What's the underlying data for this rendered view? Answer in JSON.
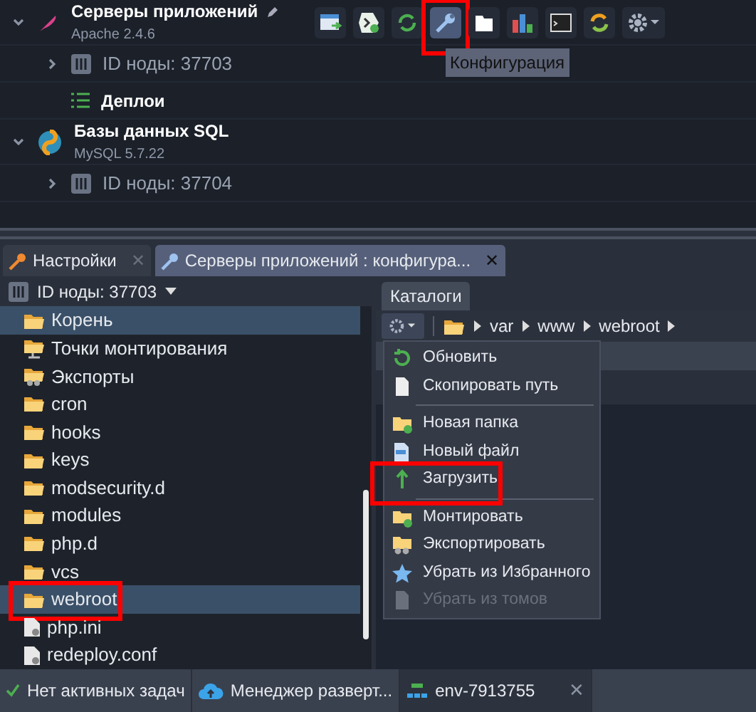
{
  "environment_tree": [
    {
      "kind": "group",
      "title": "Серверы приложений",
      "subtitle": "Apache 2.4.6",
      "expanded": true,
      "editable": true,
      "children": [
        {
          "kind": "node",
          "label": "ID ноды: 37703",
          "expanded": false
        },
        {
          "kind": "deploy",
          "label": "Деплои"
        }
      ]
    },
    {
      "kind": "group",
      "title": "Базы данных SQL",
      "subtitle": "MySQL 5.7.22",
      "expanded": true,
      "editable": false,
      "children": [
        {
          "kind": "node",
          "label": "ID ноды: 37704",
          "expanded": false
        }
      ]
    }
  ],
  "toolbar": {
    "buttons": [
      {
        "kind": "open",
        "selected": false,
        "highlighted": false
      },
      {
        "kind": "add",
        "selected": false,
        "highlighted": false
      },
      {
        "kind": "restart",
        "selected": false,
        "highlighted": false
      },
      {
        "kind": "config",
        "selected": true,
        "highlighted": true
      },
      {
        "kind": "files",
        "selected": false,
        "highlighted": false
      },
      {
        "kind": "stats",
        "selected": false,
        "highlighted": false
      },
      {
        "kind": "terminal",
        "selected": false,
        "highlighted": false
      },
      {
        "kind": "redeploy",
        "selected": false,
        "highlighted": false
      },
      {
        "kind": "settings",
        "selected": false,
        "highlighted": false
      }
    ],
    "tooltip": "Конфигурация"
  },
  "tabs": [
    {
      "label": "Настройки",
      "close": "✕",
      "selected": false
    },
    {
      "label": "Серверы приложений : конфигура...",
      "close": "✕",
      "selected": true
    }
  ],
  "file_tree": {
    "node_selector": "ID ноды: 37703",
    "items": [
      {
        "label": "Корень",
        "kind": "root",
        "selected": true,
        "highlighted": false
      },
      {
        "label": "Точки монтирования",
        "kind": "mount",
        "selected": false,
        "highlighted": false
      },
      {
        "label": "Экспорты",
        "kind": "export",
        "selected": false,
        "highlighted": false
      },
      {
        "label": "cron",
        "kind": "folder",
        "selected": false,
        "highlighted": false
      },
      {
        "label": "hooks",
        "kind": "folder",
        "selected": false,
        "highlighted": false
      },
      {
        "label": "keys",
        "kind": "folder",
        "selected": false,
        "highlighted": false
      },
      {
        "label": "modsecurity.d",
        "kind": "folder",
        "selected": false,
        "highlighted": false
      },
      {
        "label": "modules",
        "kind": "folder",
        "selected": false,
        "highlighted": false
      },
      {
        "label": "php.d",
        "kind": "folder",
        "selected": false,
        "highlighted": false
      },
      {
        "label": "vcs",
        "kind": "folder",
        "selected": false,
        "highlighted": false
      },
      {
        "label": "webroot",
        "kind": "folder",
        "selected": true,
        "highlighted": true
      },
      {
        "label": "php.ini",
        "kind": "file",
        "selected": false,
        "highlighted": false
      },
      {
        "label": "redeploy.conf",
        "kind": "file",
        "selected": false,
        "highlighted": false
      }
    ]
  },
  "catalog_tab": "Каталоги",
  "breadcrumb": [
    "var",
    "www",
    "webroot"
  ],
  "context_menu": [
    {
      "label": "Обновить",
      "kind": "refresh",
      "disabled": false,
      "separator_before": false,
      "highlighted": false
    },
    {
      "label": "Скопировать путь",
      "kind": "copy",
      "disabled": false,
      "separator_before": false,
      "highlighted": false
    },
    {
      "label": "Новая папка",
      "kind": "new_folder",
      "disabled": false,
      "separator_before": true,
      "highlighted": false
    },
    {
      "label": "Новый файл",
      "kind": "new_file",
      "disabled": false,
      "separator_before": false,
      "highlighted": false
    },
    {
      "label": "Загрузить",
      "kind": "upload",
      "disabled": false,
      "separator_before": false,
      "highlighted": true
    },
    {
      "label": "Монтировать",
      "kind": "mount",
      "disabled": false,
      "separator_before": true,
      "highlighted": false
    },
    {
      "label": "Экспортировать",
      "kind": "export",
      "disabled": false,
      "separator_before": false,
      "highlighted": false
    },
    {
      "label": "Убрать из Избранного",
      "kind": "star",
      "disabled": false,
      "separator_before": false,
      "highlighted": false
    },
    {
      "label": "Убрать из томов",
      "kind": "volume",
      "disabled": true,
      "separator_before": false,
      "highlighted": false
    }
  ],
  "taskbar": [
    {
      "kind": "status",
      "label": "Нет активных задач",
      "selected": false
    },
    {
      "kind": "deploy",
      "label": "Менеджер разверт...",
      "selected": false
    },
    {
      "kind": "env",
      "label": "env-7913755",
      "close": "✕",
      "selected": true
    }
  ]
}
